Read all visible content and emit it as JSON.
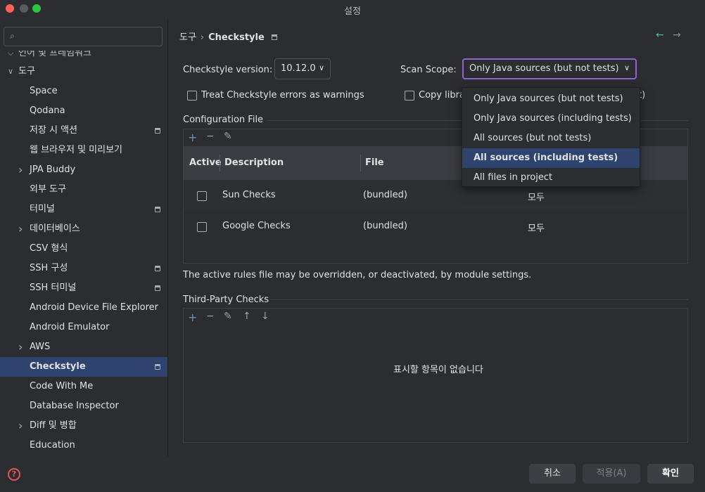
{
  "window": {
    "title": "설정"
  },
  "search": {
    "value": "",
    "placeholder": ""
  },
  "sidebar": {
    "partial_item": "언어 및 프레임워크",
    "section": "도구",
    "items": [
      {
        "label": "Space",
        "chev": false,
        "pin": false
      },
      {
        "label": "Qodana",
        "chev": false,
        "pin": false
      },
      {
        "label": "저장 시 액션",
        "chev": false,
        "pin": true
      },
      {
        "label": "웹 브라우저 및 미리보기",
        "chev": false,
        "pin": false
      },
      {
        "label": "JPA Buddy",
        "chev": true,
        "pin": false
      },
      {
        "label": "외부 도구",
        "chev": false,
        "pin": false
      },
      {
        "label": "터미널",
        "chev": false,
        "pin": true
      },
      {
        "label": "데이터베이스",
        "chev": true,
        "pin": false
      },
      {
        "label": "CSV 형식",
        "chev": false,
        "pin": false
      },
      {
        "label": "SSH 구성",
        "chev": false,
        "pin": true
      },
      {
        "label": "SSH 터미널",
        "chev": false,
        "pin": true
      },
      {
        "label": "Android Device File Explorer",
        "chev": false,
        "pin": false
      },
      {
        "label": "Android Emulator",
        "chev": false,
        "pin": false
      },
      {
        "label": "AWS",
        "chev": true,
        "pin": false
      },
      {
        "label": "Checkstyle",
        "chev": false,
        "pin": true,
        "selected": true
      },
      {
        "label": "Code With Me",
        "chev": false,
        "pin": false
      },
      {
        "label": "Database Inspector",
        "chev": false,
        "pin": false
      },
      {
        "label": "Diff 및 병합",
        "chev": true,
        "pin": false
      },
      {
        "label": "Education",
        "chev": false,
        "pin": false
      }
    ]
  },
  "breadcrumb": {
    "parent": "도구",
    "current": "Checkstyle"
  },
  "form": {
    "version_label": "Checkstyle version:",
    "version_value": "10.12.0",
    "scope_label": "Scan Scope:",
    "scope_value": "Only Java sources (but not tests)",
    "treat_errors_label": "Treat Checkstyle errors as warnings",
    "copy_libs_label_visible": "Copy libra",
    "copy_libs_tail_visible": "t)"
  },
  "config": {
    "title": "Configuration File",
    "columns": [
      "Active",
      "Description",
      "File"
    ],
    "rows": [
      {
        "description": "Sun Checks",
        "file": "(bundled)",
        "scope": "모두"
      },
      {
        "description": "Google Checks",
        "file": "(bundled)",
        "scope": "모두"
      }
    ],
    "info": "The active rules file may be overridden, or deactivated, by module settings."
  },
  "third_party": {
    "title": "Third-Party Checks",
    "empty_text": "표시할 항목이 없습니다"
  },
  "dropdown": {
    "options": [
      "Only Java sources (but not tests)",
      "Only Java sources (including tests)",
      "All sources (but not tests)",
      "All sources (including tests)",
      "All files in project"
    ],
    "highlighted": "All sources (including tests)"
  },
  "footer": {
    "cancel": "취소",
    "apply": "적용(A)",
    "ok": "확인",
    "help": "?"
  },
  "colors": {
    "accent": "#8f63d4",
    "selection": "#2e436e",
    "add_icon": "#5a8fd8",
    "back_arrow": "#4dbb93"
  }
}
